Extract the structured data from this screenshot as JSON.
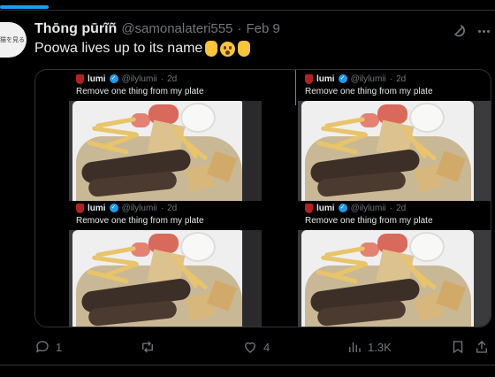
{
  "tweet": {
    "avatar_text": "猫を見る",
    "author_name": "Thōng pūrĩñ",
    "author_handle": "@samonalateri555",
    "separator": "·",
    "date": "Feb 9",
    "text": "Poowa lives up to its name",
    "emoji": [
      "raised-hand",
      "astonished-face",
      "waving-hand"
    ]
  },
  "quoted": {
    "name": "lumi",
    "handle": "@ilylumii",
    "separator": "·",
    "age": "2d",
    "text": "Remove one thing from my plate"
  },
  "actions": {
    "replies": "1",
    "reposts": "",
    "likes": "4",
    "views": "1.3K"
  },
  "colors": {
    "accent": "#1d9bf0",
    "text": "#e7e9ea",
    "muted": "#71767b",
    "background": "#000000",
    "border": "#2f3336"
  },
  "icons": {
    "header": [
      "grok-icon",
      "more-icon"
    ],
    "actions": [
      "reply-icon",
      "repost-icon",
      "like-icon",
      "views-icon",
      "bookmark-icon",
      "share-icon"
    ]
  }
}
